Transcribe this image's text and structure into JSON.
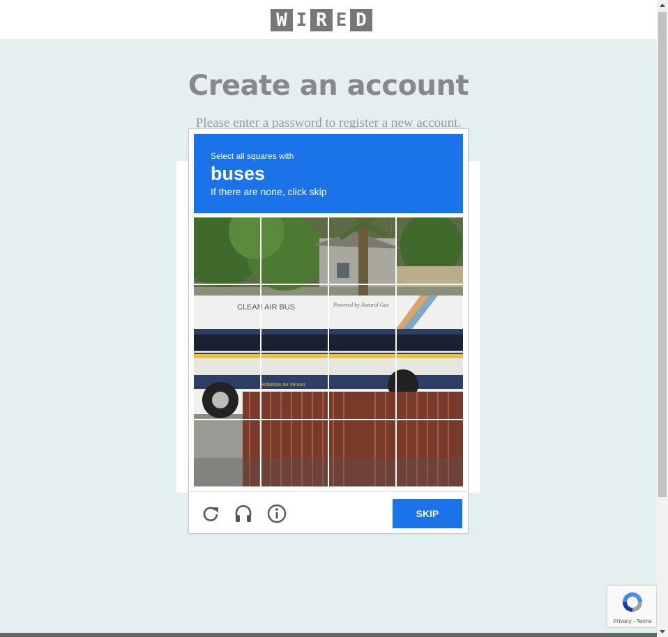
{
  "brand": {
    "logo_letters": [
      "W",
      "I",
      "R",
      "E",
      "D"
    ]
  },
  "page": {
    "title": "Create an account",
    "subtitle": "Please enter a password to register a new account."
  },
  "captcha": {
    "instruction": "Select all squares with",
    "target": "buses",
    "note": "If there are none, click skip",
    "image_text": {
      "bus_side": "CLEAN AIR BUS",
      "bus_script": "Powered by Natural Gas",
      "bus_lower": "Robledas de Verano"
    },
    "tile_count": 16,
    "footer": {
      "reload_icon": "reload-icon",
      "audio_icon": "headphones-icon",
      "info_icon": "info-icon",
      "skip_label": "SKIP"
    },
    "colors": {
      "accent": "#1a73e8"
    }
  },
  "recaptcha_badge": {
    "links": "Privacy - Terms"
  }
}
